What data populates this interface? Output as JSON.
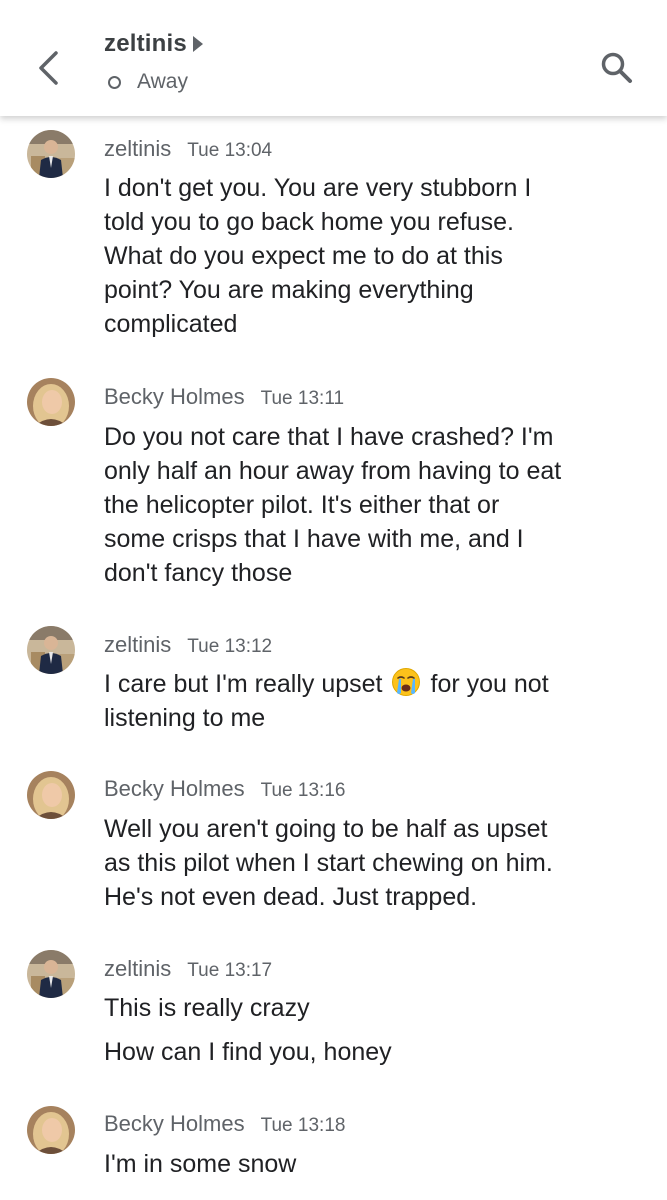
{
  "header": {
    "contact_name": "zeltinis",
    "status": "Away",
    "back_icon": "chevron-left-icon",
    "search_icon": "search-icon"
  },
  "messages": [
    {
      "sender": "zeltinis",
      "time": "Tue 13:04",
      "lines": [
        "I don't get you. You are very stubborn I",
        "told you to go back home you refuse.",
        "What do you expect me to do at this",
        "point? You are making everything",
        "complicated"
      ]
    },
    {
      "sender": "Becky Holmes",
      "time": "Tue 13:11",
      "lines": [
        "Do you not care that I have crashed? I'm",
        "only half an hour away from having to eat",
        "the helicopter pilot. It's either that or",
        "some crisps that I have with me, and I",
        "don't fancy those"
      ]
    },
    {
      "sender": "zeltinis",
      "time": "Tue 13:12",
      "line1_before_emoji": "I care but I'm really upset",
      "emoji": "crying-face-icon",
      "line1_after_emoji": "for you not",
      "lines": [
        "listening to me"
      ]
    },
    {
      "sender": "Becky Holmes",
      "time": "Tue 13:16",
      "lines": [
        "Well you aren't going to be half as upset",
        "as this pilot when I start chewing on him.",
        "He's not even dead. Just trapped."
      ]
    },
    {
      "sender": "zeltinis",
      "time": "Tue 13:17",
      "lines": [
        "This is really crazy"
      ],
      "followup": "How can I find you, honey"
    },
    {
      "sender": "Becky Holmes",
      "time": "Tue 13:18",
      "lines": [
        "I'm in some snow"
      ]
    }
  ]
}
